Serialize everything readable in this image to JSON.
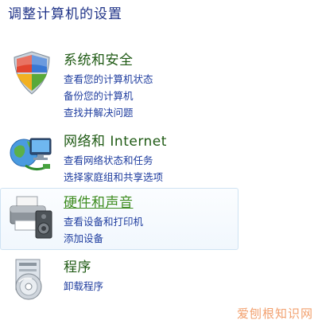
{
  "page": {
    "title": "调整计算机的设置"
  },
  "categories": [
    {
      "id": "system-security",
      "title": "系统和安全",
      "icon": "shield-icon",
      "links": [
        "查看您的计算机状态",
        "备份您的计算机",
        "查找并解决问题"
      ]
    },
    {
      "id": "network-internet",
      "title": "网络和 Internet",
      "icon": "network-globe-icon",
      "links": [
        "查看网络状态和任务",
        "选择家庭组和共享选项"
      ]
    },
    {
      "id": "hardware-sound",
      "title": "硬件和声音",
      "icon": "printer-speaker-icon",
      "highlighted": true,
      "links": [
        "查看设备和打印机",
        "添加设备"
      ]
    },
    {
      "id": "programs",
      "title": "程序",
      "icon": "programs-disc-icon",
      "links": [
        "卸载程序"
      ]
    }
  ],
  "watermark": {
    "text": "爱刨根知识网"
  },
  "colors": {
    "title": "#1e3287",
    "category_title": "#1f5a14",
    "category_title_hover": "#3d8c1f",
    "link": "#1f3d9f",
    "hover_border": "#cfe3f3",
    "watermark": "#f2a06e"
  }
}
